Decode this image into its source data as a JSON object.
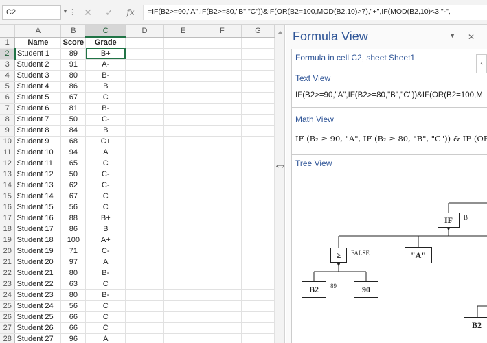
{
  "formula_bar": {
    "cell_ref": "C2",
    "cancel_glyph": "✕",
    "enter_glyph": "✓",
    "fx_label": "fx",
    "formula": "=IF(B2>=90,\"A\",IF(B2>=80,\"B\",\"C\"))&IF(OR(B2=100,MOD(B2,10)>7),\"+\",IF(MOD(B2,10)<3,\"-\","
  },
  "columns": [
    "A",
    "B",
    "C",
    "D",
    "E",
    "F",
    "G"
  ],
  "header_row": {
    "row": "1",
    "name": "Name",
    "score": "Score",
    "grade": "Grade"
  },
  "rows": [
    {
      "row": "2",
      "name": "Student 1",
      "score": "89",
      "grade": "B+"
    },
    {
      "row": "3",
      "name": "Student 2",
      "score": "91",
      "grade": "A-"
    },
    {
      "row": "4",
      "name": "Student 3",
      "score": "80",
      "grade": "B-"
    },
    {
      "row": "5",
      "name": "Student 4",
      "score": "86",
      "grade": "B"
    },
    {
      "row": "6",
      "name": "Student 5",
      "score": "67",
      "grade": "C"
    },
    {
      "row": "7",
      "name": "Student 6",
      "score": "81",
      "grade": "B-"
    },
    {
      "row": "8",
      "name": "Student 7",
      "score": "50",
      "grade": "C-"
    },
    {
      "row": "9",
      "name": "Student 8",
      "score": "84",
      "grade": "B"
    },
    {
      "row": "10",
      "name": "Student 9",
      "score": "68",
      "grade": "C+"
    },
    {
      "row": "11",
      "name": "Student 10",
      "score": "94",
      "grade": "A"
    },
    {
      "row": "12",
      "name": "Student 11",
      "score": "65",
      "grade": "C"
    },
    {
      "row": "13",
      "name": "Student 12",
      "score": "50",
      "grade": "C-"
    },
    {
      "row": "14",
      "name": "Student 13",
      "score": "62",
      "grade": "C-"
    },
    {
      "row": "15",
      "name": "Student 14",
      "score": "67",
      "grade": "C"
    },
    {
      "row": "16",
      "name": "Student 15",
      "score": "56",
      "grade": "C"
    },
    {
      "row": "17",
      "name": "Student 16",
      "score": "88",
      "grade": "B+"
    },
    {
      "row": "18",
      "name": "Student 17",
      "score": "86",
      "grade": "B"
    },
    {
      "row": "19",
      "name": "Student 18",
      "score": "100",
      "grade": "A+"
    },
    {
      "row": "20",
      "name": "Student 19",
      "score": "71",
      "grade": "C-"
    },
    {
      "row": "21",
      "name": "Student 20",
      "score": "97",
      "grade": "A"
    },
    {
      "row": "22",
      "name": "Student 21",
      "score": "80",
      "grade": "B-"
    },
    {
      "row": "23",
      "name": "Student 22",
      "score": "63",
      "grade": "C"
    },
    {
      "row": "24",
      "name": "Student 23",
      "score": "80",
      "grade": "B-"
    },
    {
      "row": "25",
      "name": "Student 24",
      "score": "56",
      "grade": "C"
    },
    {
      "row": "26",
      "name": "Student 25",
      "score": "66",
      "grade": "C"
    },
    {
      "row": "27",
      "name": "Student 26",
      "score": "66",
      "grade": "C"
    },
    {
      "row": "28",
      "name": "Student 27",
      "score": "96",
      "grade": "A"
    }
  ],
  "pane": {
    "title": "Formula View",
    "formula_location": "Formula in cell C2, sheet Sheet1",
    "text_view_title": "Text View",
    "text_view_content": "IF(B2>=90,\"A\",IF(B2>=80,\"B\",\"C\"))&IF(OR(B2=100,M",
    "math_view_title": "Math View",
    "math_view_content": "IF (B₂ ≥ 90, \"A\", IF (B₂ ≥ 80, \"B\", \"C\")) & IF (OR (",
    "tree_view_title": "Tree View",
    "tree": {
      "if_node": "IF",
      "if_label": "B",
      "gte_node": "≥",
      "gte_label": "FALSE",
      "a_node": "\"A\"",
      "b2_node": "B2",
      "b2_value": "89",
      "ninety_node": "90",
      "b2_lower_node": "B2"
    }
  }
}
